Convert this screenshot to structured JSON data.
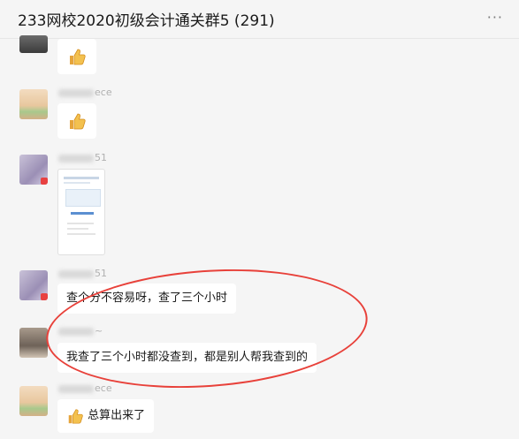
{
  "window": {
    "title": "233网校2020初级会计通关群5 (291)",
    "more_icon": "more-horizontal-icon"
  },
  "messages": [
    {
      "type": "emoji",
      "emoji": "thumbs-up-icon"
    },
    {
      "type": "emoji",
      "sender": "ece",
      "emoji": "thumbs-up-icon"
    },
    {
      "type": "image",
      "sender": "51"
    },
    {
      "type": "text",
      "sender": "51",
      "text": "查个分不容易呀，查了三个小时"
    },
    {
      "type": "text",
      "sender": "~",
      "text": "我查了三个小时都没查到，都是别人帮我查到的"
    },
    {
      "type": "emoji-text",
      "sender": "ece",
      "emoji": "thumbs-up-icon",
      "text": "总算出来了"
    }
  ],
  "colors": {
    "background": "#f5f5f5",
    "bubble": "#ffffff",
    "annotation": "#e8413a"
  }
}
